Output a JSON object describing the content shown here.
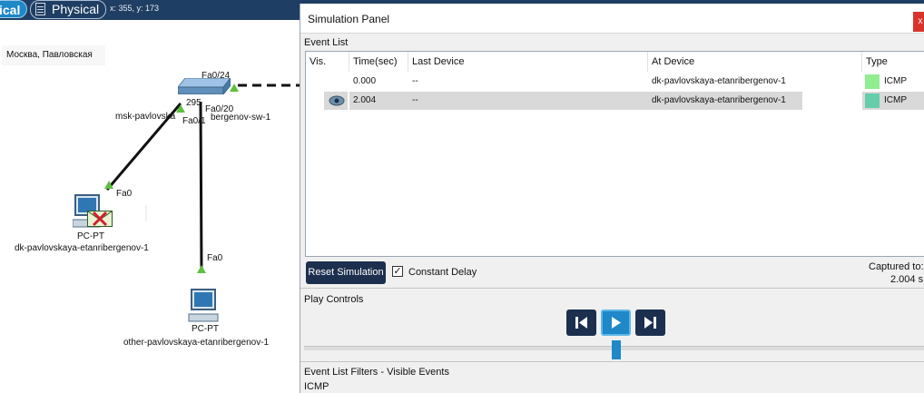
{
  "topbar": {
    "logical_tab": "ical",
    "physical_tab": "Physical",
    "coords": "x: 355, y: 173"
  },
  "canvas": {
    "location_label": "Москва, Павловская",
    "switch": {
      "name_left": "msk-pavlovska",
      "name_right": "bergenov-sw-1",
      "model": "295",
      "port_top": "Fa0/24",
      "port_mid": "Fa0/20",
      "port_left": "Fa0/1"
    },
    "pc1": {
      "type": "PC-PT",
      "name": "dk-pavlovskaya-etanribergenov-1",
      "port": "Fa0"
    },
    "pc2": {
      "type": "PC-PT",
      "name": "other-pavlovskaya-etanribergenov-1",
      "port": "Fa0"
    }
  },
  "panel": {
    "title": "Simulation Panel",
    "close": "x",
    "event_list_title": "Event List",
    "columns": {
      "vis": "Vis.",
      "time": "Time(sec)",
      "last_device": "Last Device",
      "at_device": "At Device",
      "type": "Type"
    },
    "events": [
      {
        "time": "0.000",
        "last_device": "--",
        "at_device": "dk-pavlovskaya-etanribergenov-1",
        "type": "ICMP",
        "color": "#90ee90"
      },
      {
        "time": "2.004",
        "last_device": "--",
        "at_device": "dk-pavlovskaya-etanribergenov-1",
        "type": "ICMP",
        "color": "#66cdaa"
      }
    ],
    "reset_button": "Reset Simulation",
    "constant_delay_label": "Constant Delay",
    "constant_delay_checked": true,
    "captured_label": "Captured to:",
    "captured_value": "2.004 s",
    "play_controls_title": "Play Controls",
    "filters_title": "Event List Filters - Visible Events",
    "filters_value": "ICMP"
  },
  "colors": {
    "accent": "#1e88c8",
    "navy": "#1c2f4f",
    "link_green": "#5fbf3f"
  }
}
